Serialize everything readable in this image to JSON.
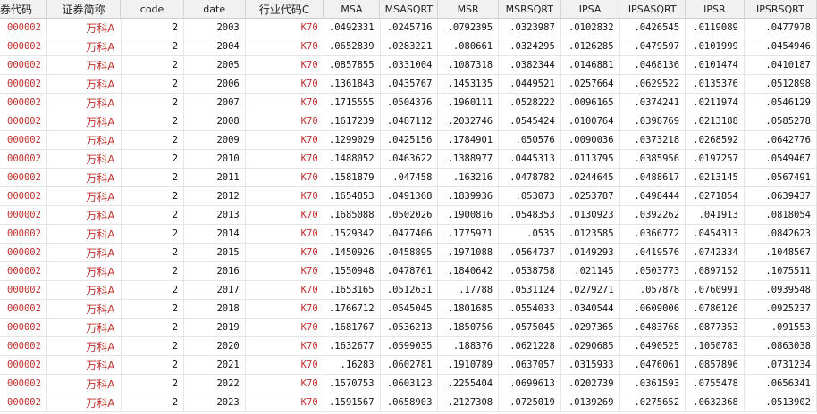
{
  "columns": [
    "券代码",
    "证券简称",
    "code",
    "date",
    "行业代码C",
    "MSA",
    "MSASQRT",
    "MSR",
    "MSRSQRT",
    "IPSA",
    "IPSASQRT",
    "IPSR",
    "IPSRSQRT"
  ],
  "rows": [
    [
      "000002",
      "万科A",
      "2",
      "2003",
      "K70",
      ".0492331",
      ".0245716",
      ".0792395",
      ".0323987",
      ".0102832",
      ".0426545",
      ".0119089",
      ".0477978"
    ],
    [
      "000002",
      "万科A",
      "2",
      "2004",
      "K70",
      ".0652839",
      ".0283221",
      ".080661",
      ".0324295",
      ".0126285",
      ".0479597",
      ".0101999",
      ".0454946"
    ],
    [
      "000002",
      "万科A",
      "2",
      "2005",
      "K70",
      ".0857855",
      ".0331004",
      ".1087318",
      ".0382344",
      ".0146881",
      ".0468136",
      ".0101474",
      ".0410187"
    ],
    [
      "000002",
      "万科A",
      "2",
      "2006",
      "K70",
      ".1361843",
      ".0435767",
      ".1453135",
      ".0449521",
      ".0257664",
      ".0629522",
      ".0135376",
      ".0512898"
    ],
    [
      "000002",
      "万科A",
      "2",
      "2007",
      "K70",
      ".1715555",
      ".0504376",
      ".1960111",
      ".0528222",
      ".0096165",
      ".0374241",
      ".0211974",
      ".0546129"
    ],
    [
      "000002",
      "万科A",
      "2",
      "2008",
      "K70",
      ".1617239",
      ".0487112",
      ".2032746",
      ".0545424",
      ".0100764",
      ".0398769",
      ".0213188",
      ".0585278"
    ],
    [
      "000002",
      "万科A",
      "2",
      "2009",
      "K70",
      ".1299029",
      ".0425156",
      ".1784901",
      ".050576",
      ".0090036",
      ".0373218",
      ".0268592",
      ".0642776"
    ],
    [
      "000002",
      "万科A",
      "2",
      "2010",
      "K70",
      ".1488052",
      ".0463622",
      ".1388977",
      ".0445313",
      ".0113795",
      ".0385956",
      ".0197257",
      ".0549467"
    ],
    [
      "000002",
      "万科A",
      "2",
      "2011",
      "K70",
      ".1581879",
      ".047458",
      ".163216",
      ".0478782",
      ".0244645",
      ".0488617",
      ".0213145",
      ".0567491"
    ],
    [
      "000002",
      "万科A",
      "2",
      "2012",
      "K70",
      ".1654853",
      ".0491368",
      ".1839936",
      ".053073",
      ".0253787",
      ".0498444",
      ".0271854",
      ".0639437"
    ],
    [
      "000002",
      "万科A",
      "2",
      "2013",
      "K70",
      ".1685088",
      ".0502026",
      ".1900816",
      ".0548353",
      ".0130923",
      ".0392262",
      ".041913",
      ".0818054"
    ],
    [
      "000002",
      "万科A",
      "2",
      "2014",
      "K70",
      ".1529342",
      ".0477406",
      ".1775971",
      ".0535",
      ".0123585",
      ".0366772",
      ".0454313",
      ".0842623"
    ],
    [
      "000002",
      "万科A",
      "2",
      "2015",
      "K70",
      ".1450926",
      ".0458895",
      ".1971088",
      ".0564737",
      ".0149293",
      ".0419576",
      ".0742334",
      ".1048567"
    ],
    [
      "000002",
      "万科A",
      "2",
      "2016",
      "K70",
      ".1550948",
      ".0478761",
      ".1840642",
      ".0538758",
      ".021145",
      ".0503773",
      ".0897152",
      ".1075511"
    ],
    [
      "000002",
      "万科A",
      "2",
      "2017",
      "K70",
      ".1653165",
      ".0512631",
      ".17788",
      ".0531124",
      ".0279271",
      ".057878",
      ".0760991",
      ".0939548"
    ],
    [
      "000002",
      "万科A",
      "2",
      "2018",
      "K70",
      ".1766712",
      ".0545045",
      ".1801685",
      ".0554033",
      ".0340544",
      ".0609006",
      ".0786126",
      ".0925237"
    ],
    [
      "000002",
      "万科A",
      "2",
      "2019",
      "K70",
      ".1681767",
      ".0536213",
      ".1850756",
      ".0575045",
      ".0297365",
      ".0483768",
      ".0877353",
      ".091553"
    ],
    [
      "000002",
      "万科A",
      "2",
      "2020",
      "K70",
      ".1632677",
      ".0599035",
      ".188376",
      ".0621228",
      ".0290685",
      ".0490525",
      ".1050783",
      ".0863038"
    ],
    [
      "000002",
      "万科A",
      "2",
      "2021",
      "K70",
      ".16283",
      ".0602781",
      ".1910789",
      ".0637057",
      ".0315933",
      ".0476061",
      ".0857896",
      ".0731234"
    ],
    [
      "000002",
      "万科A",
      "2",
      "2022",
      "K70",
      ".1570753",
      ".0603123",
      ".2255404",
      ".0699613",
      ".0202739",
      ".0361593",
      ".0755478",
      ".0656341"
    ],
    [
      "000002",
      "万科A",
      "2",
      "2023",
      "K70",
      ".1591567",
      ".0658903",
      ".2127308",
      ".0725019",
      ".0139269",
      ".0275652",
      ".0632368",
      ".0513902"
    ]
  ],
  "colors": {
    "string_value": "#c0302b",
    "numeric_value": "#111111",
    "header_bg": "#f1f1f1",
    "grid_line": "#e4e4e4"
  }
}
